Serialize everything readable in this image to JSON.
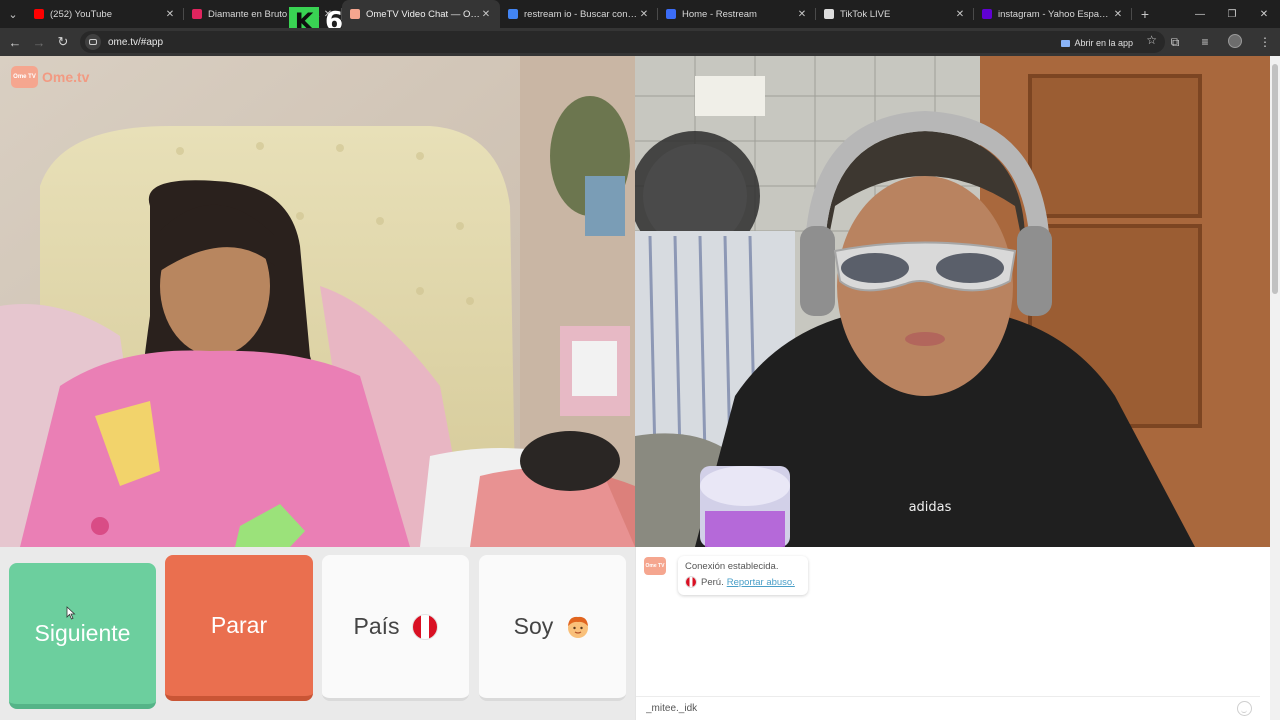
{
  "browser": {
    "tabs": [
      {
        "title": "(252) YouTube",
        "favicon_color": "#ff0000",
        "active": false
      },
      {
        "title": "Diamante en Bruto | YouTube",
        "favicon_color": "#e0245e",
        "active": false
      },
      {
        "title": "OmeTV Video Chat — Ome",
        "favicon_color": "#f5a68f",
        "active": true
      },
      {
        "title": "restream io - Buscar con Google",
        "favicon_color": "#4285f4",
        "active": false
      },
      {
        "title": "Home - Restream",
        "favicon_color": "#3b6cf6",
        "active": false
      },
      {
        "title": "TikTok LIVE",
        "favicon_color": "#dddddd",
        "active": false
      },
      {
        "title": "instagram - Yahoo España Resultados",
        "favicon_color": "#6001d2",
        "active": false
      }
    ],
    "url": "ome.tv/#app",
    "open_in_app_label": "Abrir en la app"
  },
  "overlay": {
    "badge_letter": "K",
    "badge_number": "6"
  },
  "app": {
    "logo_text": "Ome.tv",
    "logo_icon_text": "Ome TV"
  },
  "controls": {
    "next_label": "Siguiente",
    "stop_label": "Parar",
    "country_label": "País",
    "gender_label": "Soy"
  },
  "chat": {
    "message_line1": "Conexión establecida.",
    "message_country": "Perú.",
    "report_link": "Reportar abuso.",
    "input_value": "_mitee._idk",
    "logo_icon_text": "Ome TV"
  },
  "colors": {
    "next": "#6ccf9e",
    "stop": "#ea6f4f",
    "brand": "#f29a82"
  }
}
